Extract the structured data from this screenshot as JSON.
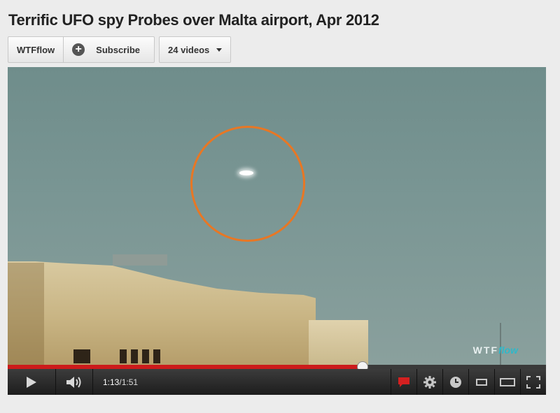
{
  "page": {
    "title": "Terrific UFO spy Probes over Malta airport, Apr 2012"
  },
  "channel": {
    "name": "WTFflow",
    "subscribe_label": "Subscribe",
    "videos_label": "24 videos"
  },
  "player": {
    "watermark_a": "WTF",
    "watermark_b": "flow",
    "progress_fraction": 0.658,
    "current_time": "1:13",
    "separator": " / ",
    "duration": "1:51",
    "colors": {
      "progress": "#cc1b1b",
      "highlight_circle": "#e87724"
    }
  },
  "icons": [
    "play-icon",
    "volume-icon",
    "annotations-icon",
    "settings-gear-icon",
    "watch-later-icon",
    "small-player-icon",
    "large-player-icon",
    "fullscreen-icon"
  ]
}
